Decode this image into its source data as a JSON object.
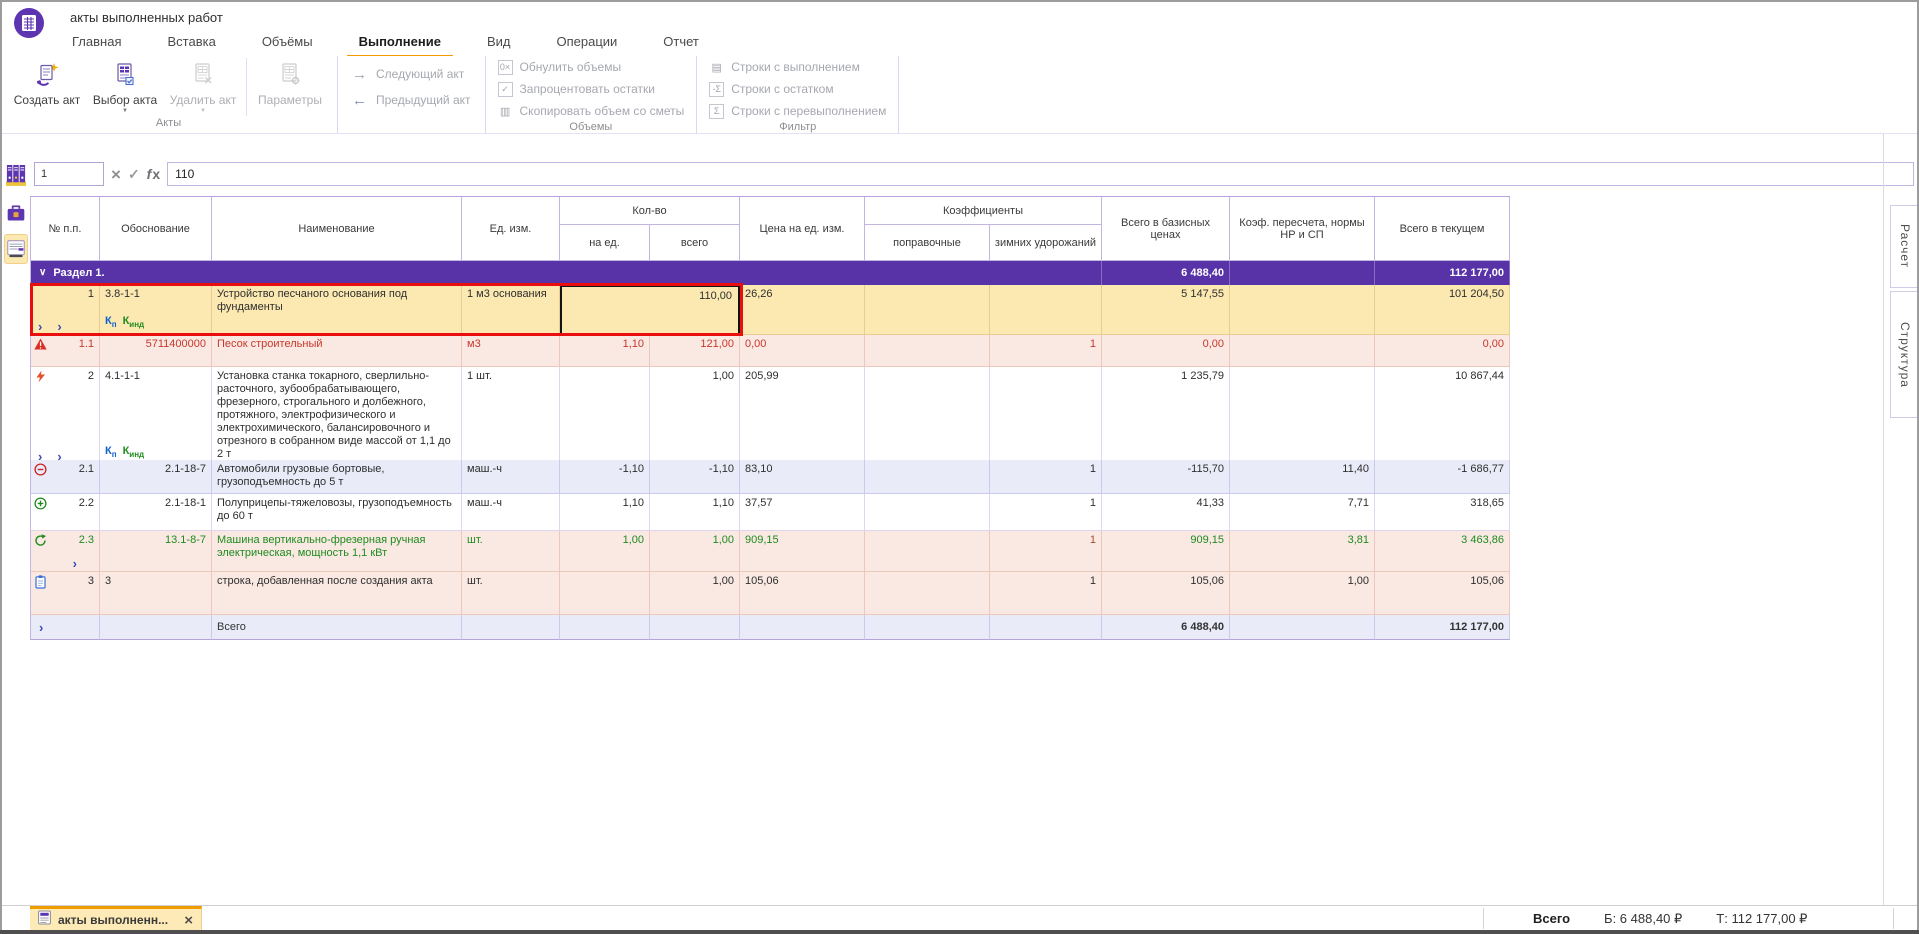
{
  "window": {
    "title": "акты выполненных работ"
  },
  "tabs": {
    "items": [
      "Главная",
      "Вставка",
      "Объёмы",
      "Выполнение",
      "Вид",
      "Операции",
      "Отчет"
    ],
    "active": "Выполнение"
  },
  "ribbon": {
    "acts": {
      "label": "Акты",
      "create": "Создать акт",
      "select": "Выбор акта",
      "remove": "Удалить акт",
      "params": "Параметры"
    },
    "nav": {
      "next": "Следующий акт",
      "prev": "Предыдущий акт"
    },
    "volumes": {
      "label": "Объемы",
      "reset": "Обнулить объемы",
      "percent": "Запроцентовать остатки",
      "copy": "Скопировать объем со сметы"
    },
    "filter": {
      "label": "Фильтр",
      "done": "Строки с выполнением",
      "remain": "Строки с остатком",
      "over": "Строки с перевыполнением"
    }
  },
  "formula_bar": {
    "cell_ref": "1",
    "value": "110"
  },
  "icons": {
    "close": "×",
    "check": "✓",
    "fx_f": "f",
    "fx_x": "x",
    "dropdown": "▼",
    "arrow_next": "→",
    "arrow_prev": "←",
    "chevron": "›",
    "section_chevron": "∨",
    "reset": "0×",
    "percent": "✓",
    "copy": "▥",
    "rows_done": "▤",
    "rows_remain": "-Σ",
    "rows_over": "Σ"
  },
  "table": {
    "headers": {
      "num": "№ п.п.",
      "just": "Обоснование",
      "name": "Наименование",
      "unit": "Ед. изм.",
      "qty_group": "Кол-во",
      "qty_unit": "на ед.",
      "qty_total": "всего",
      "price": "Цена на ед. изм.",
      "coef_group": "Коэффициенты",
      "coef_corr": "поправочные",
      "coef_winter": "зимних удорожаний",
      "total_base": "Всего в базисных ценах",
      "conv": "Коэф. пересчета, нормы НР и СП",
      "total_cur": "Всего в текущем"
    },
    "section": {
      "label": "Раздел 1.",
      "total_base": "6 488,40",
      "total_cur": "112 177,00"
    },
    "badges": {
      "kp_base": "К",
      "kp_sub": "п",
      "kind_base": "К",
      "kind_sub": "инд"
    },
    "rows": [
      {
        "num": "1",
        "just": "3.8-1-1",
        "name": "Устройство песчаного основания под фундаменты",
        "unit": "1 м3 основания",
        "qty": "110,00",
        "price": "26,26",
        "corr": "",
        "winter": "",
        "total_base": "5 147,55",
        "conv": "",
        "total_cur": "101 204,50"
      },
      {
        "num": "1.1",
        "just": "5711400000",
        "name": "Песок строительный",
        "unit": "м3",
        "qty_unit": "1,10",
        "qty_total": "121,00",
        "price": "0,00",
        "corr": "",
        "winter": "1",
        "total_base": "0,00",
        "conv": "",
        "total_cur": "0,00"
      },
      {
        "num": "2",
        "just": "4.1-1-1",
        "name": "Установка станка токарного, сверлильно-расточного, зубообрабатывающего, фрезерного, строгального и долбежного, протяжного, электрофизического и электрохимического, балансировочного и отрезного в собранном виде массой от 1,1 до 2 т",
        "unit": "1 шт.",
        "qty_unit": "",
        "qty_total": "1,00",
        "price": "205,99",
        "corr": "",
        "winter": "",
        "total_base": "1 235,79",
        "conv": "",
        "total_cur": "10 867,44"
      },
      {
        "num": "2.1",
        "just": "2.1-18-7",
        "name": "Автомобили грузовые бортовые, грузоподъемность до 5 т",
        "unit": "маш.-ч",
        "qty_unit": "-1,10",
        "qty_total": "-1,10",
        "price": "83,10",
        "corr": "",
        "winter": "1",
        "total_base": "-115,70",
        "conv": "11,40",
        "total_cur": "-1 686,77"
      },
      {
        "num": "2.2",
        "just": "2.1-18-1",
        "name": "Полуприцепы-тяжеловозы, грузоподъемность до 60 т",
        "unit": "маш.-ч",
        "qty_unit": "1,10",
        "qty_total": "1,10",
        "price": "37,57",
        "corr": "",
        "winter": "1",
        "total_base": "41,33",
        "conv": "7,71",
        "total_cur": "318,65"
      },
      {
        "num": "2.3",
        "just": "13.1-8-7",
        "name": "Машина вертикально-фрезерная ручная электрическая, мощность 1,1 кВт",
        "unit": "шт.",
        "qty_unit": "1,00",
        "qty_total": "1,00",
        "price": "909,15",
        "corr": "",
        "winter": "1",
        "total_base": "909,15",
        "conv": "3,81",
        "total_cur": "3 463,86"
      },
      {
        "num": "3",
        "just": "3",
        "name": "строка, добавленная после создания акта",
        "unit": "шт.",
        "qty_unit": "",
        "qty_total": "1,00",
        "price": "105,06",
        "corr": "",
        "winter": "1",
        "total_base": "105,06",
        "conv": "1,00",
        "total_cur": "105,06"
      }
    ],
    "totals": {
      "label": "Всего",
      "total_base": "6 488,40",
      "total_cur": "112 177,00"
    }
  },
  "right_tabs": {
    "calc": "Расчет",
    "structure": "Структура"
  },
  "statusbar": {
    "doc_tab": "акты выполненн...",
    "totals_label": "Всего",
    "base": "Б: 6 488,40 ₽",
    "current": "Т: 112 177,00 ₽"
  },
  "colors": {
    "accent_purple": "#5e35b1",
    "accent_orange": "#f59b00",
    "selection_red": "#e90f0f",
    "row_yellow": "#fce9b2",
    "row_pink": "#f9e9e2",
    "row_lavender": "#e9ebf8",
    "text_red": "#c9372c",
    "text_green": "#1f8b1f",
    "badge_blue": "#1161c9"
  }
}
